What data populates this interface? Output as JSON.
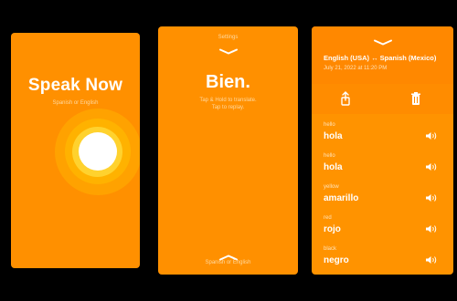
{
  "screen1": {
    "title": "Speak Now",
    "subtitle": "Spanish or English"
  },
  "screen2": {
    "settings_label": "Settings",
    "word": "Bien.",
    "hint_line1": "Tap & Hold to translate.",
    "hint_line2": "Tap to replay.",
    "language_label": "Spanish or English"
  },
  "screen3": {
    "language_pair": "English (USA) ↔ Spanish (Mexico)",
    "date": "July 21, 2022 at 11:20 PM",
    "entries": [
      {
        "source": "hello",
        "translation": "hola"
      },
      {
        "source": "hello",
        "translation": "hola"
      },
      {
        "source": "yellow",
        "translation": "amarillo"
      },
      {
        "source": "red",
        "translation": "rojo"
      },
      {
        "source": "black",
        "translation": "negro"
      }
    ]
  },
  "colors": {
    "background": "#000000",
    "accent_orange": "#ff9000",
    "mic_ring_outer": "#ffa200",
    "mic_ring_mid": "#ffb200",
    "mic_ring_inner": "#ffd22e"
  },
  "icons": [
    "chevron-down-icon",
    "chevron-up-icon",
    "share-icon",
    "trash-icon",
    "speaker-icon"
  ]
}
